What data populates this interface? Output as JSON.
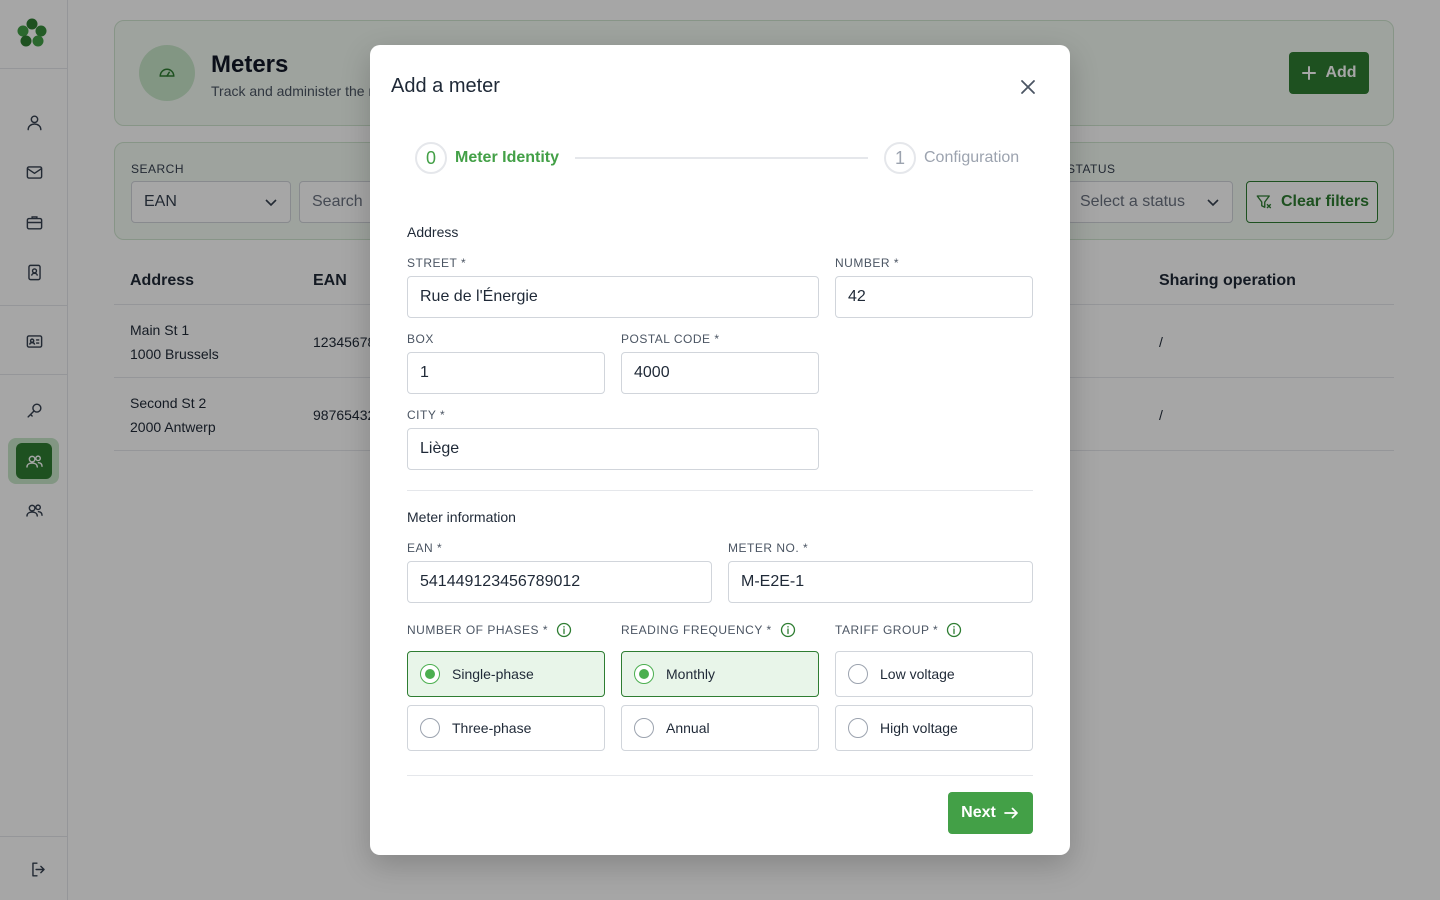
{
  "colors": {
    "brand": "#2e7d32",
    "brand_light": "#c8e6c9",
    "accent": "#43a047",
    "step_active": "#43a047",
    "step_inactive": "#9ca3af"
  },
  "sidebar": {
    "icons": [
      "logo-clover-icon",
      "user-icon",
      "mail-icon",
      "briefcase-icon",
      "id-document-icon",
      "id-card-icon",
      "key-icon",
      "users-icon",
      "users-icon",
      "logout-icon"
    ]
  },
  "header": {
    "title": "Meters",
    "subtitle": "Track and administer the meters",
    "add_label": "Add"
  },
  "filters": {
    "search_label": "SEARCH",
    "search_type": "EAN",
    "search_placeholder": "Search",
    "status_label": "STATUS",
    "status_placeholder": "Select a status",
    "clear_label": "Clear filters"
  },
  "table": {
    "headers": [
      "Address",
      "EAN",
      "Sharing operation"
    ],
    "rows": [
      {
        "address_line1": "Main St 1",
        "address_line2": "1000 Brussels",
        "ean": "12345678",
        "sharing": "/"
      },
      {
        "address_line1": "Second St 2",
        "address_line2": "2000 Antwerp",
        "ean": "98765432",
        "sharing": "/"
      }
    ]
  },
  "modal": {
    "title": "Add a meter",
    "steps": [
      {
        "number": "0",
        "label": "Meter Identity",
        "active": true
      },
      {
        "number": "1",
        "label": "Configuration",
        "active": false
      }
    ],
    "address_section": "Address",
    "street_label": "STREET *",
    "street_value": "Rue de l'Énergie",
    "number_label": "NUMBER *",
    "number_value": "42",
    "box_label": "BOX",
    "box_value": "1",
    "postal_label": "POSTAL CODE *",
    "postal_value": "4000",
    "city_label": "CITY *",
    "city_value": "Liège",
    "meter_section": "Meter information",
    "ean_label": "EAN *",
    "ean_value": "541449123456789012",
    "meterno_label": "METER NO. *",
    "meterno_value": "M-E2E-1",
    "phases_label": "NUMBER OF PHASES *",
    "phases_options": [
      "Single-phase",
      "Three-phase"
    ],
    "phases_selected": "Single-phase",
    "frequency_label": "READING FREQUENCY *",
    "frequency_options": [
      "Monthly",
      "Annual"
    ],
    "frequency_selected": "Monthly",
    "tariff_label": "TARIFF GROUP *",
    "tariff_options": [
      "Low voltage",
      "High voltage"
    ],
    "tariff_selected": "",
    "next_label": "Next"
  }
}
